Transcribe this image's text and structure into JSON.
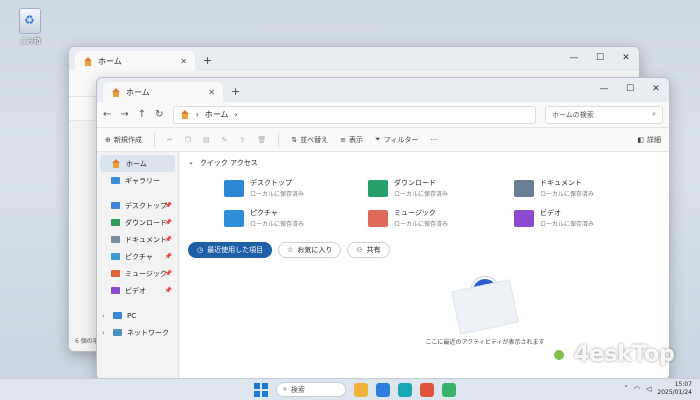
{
  "desktop": {
    "recycle_label": "ごみ箱"
  },
  "back_window": {
    "tab_title": "ホーム",
    "status": "6 個の項目"
  },
  "front_window": {
    "tab_title": "ホーム",
    "window_controls": [
      "—",
      "☐",
      "✕"
    ],
    "nav": {
      "back": "←",
      "forward": "→",
      "up": "↑",
      "refresh": "↻"
    },
    "address": {
      "crumb": "ホーム",
      "sep": "›"
    },
    "search": {
      "placeholder": "ホームの検索"
    },
    "toolbar": {
      "new": "新規作成",
      "sort": "並べ替え",
      "view": "表示",
      "filter": "フィルター",
      "more": "···",
      "details": "詳細"
    },
    "sidebar": {
      "items": [
        {
          "label": "ホーム",
          "color": "#e07b39",
          "selected": true
        },
        {
          "label": "ギャラリー",
          "color": "#3b8fd8"
        }
      ],
      "pinned": [
        {
          "label": "デスクトップ",
          "color": "#3a86d6"
        },
        {
          "label": "ダウンロード",
          "color": "#2e9a5b"
        },
        {
          "label": "ドキュメント",
          "color": "#7a8aa0"
        },
        {
          "label": "ピクチャ",
          "color": "#3a9bd6"
        },
        {
          "label": "ミュージック",
          "color": "#e0633a"
        },
        {
          "label": "ビデオ",
          "color": "#8a4ad0"
        }
      ],
      "tree": [
        {
          "label": "PC",
          "color": "#3a86d6"
        },
        {
          "label": "ネットワーク",
          "color": "#4a90c2"
        }
      ]
    },
    "quick_access": {
      "title": "クイック アクセス",
      "tiles": [
        {
          "name": "デスクトップ",
          "sub": "ローカルに保存済み",
          "color": "#2d86d6"
        },
        {
          "name": "ダウンロード",
          "sub": "ローカルに保存済み",
          "color": "#27a06b"
        },
        {
          "name": "ドキュメント",
          "sub": "ローカルに保存済み",
          "color": "#6b7f99"
        },
        {
          "name": "ピクチャ",
          "sub": "ローカルに保存済み",
          "color": "#2e8fd8"
        },
        {
          "name": "ミュージック",
          "sub": "ローカルに保存済み",
          "color": "#e06a5a"
        },
        {
          "name": "ビデオ",
          "sub": "ローカルに保存済み",
          "color": "#8b4ad0"
        }
      ]
    },
    "filters": {
      "recent": "最近使用した項目",
      "favorites": "お気に入り",
      "shared": "共有"
    },
    "empty": {
      "message": "ここに最近のアクティビティが表示されます"
    }
  },
  "taskbar": {
    "search_label": "検索",
    "time": "15:07",
    "date": "2025/01/24",
    "apps": [
      "#f0b23a",
      "#2f7de0",
      "#1aa6b7",
      "#e0533a",
      "#3ab36a"
    ]
  },
  "watermark": {
    "text": "4eskTop"
  }
}
